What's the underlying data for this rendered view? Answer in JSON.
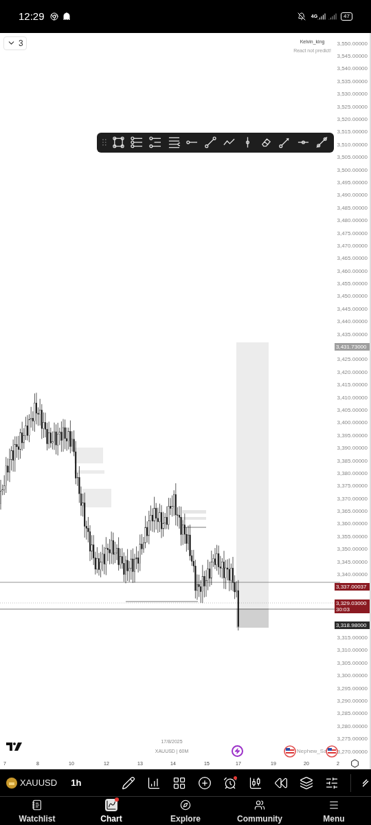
{
  "status_bar": {
    "time": "12:29",
    "network": "4G",
    "battery": "47"
  },
  "chart": {
    "layout_button": {
      "count": "3"
    },
    "author": {
      "name": "Kelvin_king",
      "note": "React not predict!"
    },
    "price_axis": [
      {
        "kind": "label",
        "text": "3,550.00000"
      },
      {
        "kind": "label",
        "text": "3,545.00000"
      },
      {
        "kind": "label",
        "text": "3,540.00000"
      },
      {
        "kind": "label",
        "text": "3,535.00000"
      },
      {
        "kind": "label",
        "text": "3,530.00000"
      },
      {
        "kind": "label",
        "text": "3,525.00000"
      },
      {
        "kind": "label",
        "text": "3,520.00000"
      },
      {
        "kind": "label",
        "text": "3,515.00000"
      },
      {
        "kind": "label",
        "text": "3,510.00000"
      },
      {
        "kind": "label",
        "text": "3,505.00000"
      },
      {
        "kind": "label",
        "text": "3,500.00000"
      },
      {
        "kind": "label",
        "text": "3,495.00000"
      },
      {
        "kind": "label",
        "text": "3,490.00000"
      },
      {
        "kind": "label",
        "text": "3,485.00000"
      },
      {
        "kind": "label",
        "text": "3,480.00000"
      },
      {
        "kind": "label",
        "text": "3,475.00000"
      },
      {
        "kind": "label",
        "text": "3,470.00000"
      },
      {
        "kind": "label",
        "text": "3,465.00000"
      },
      {
        "kind": "label",
        "text": "3,460.00000"
      },
      {
        "kind": "label",
        "text": "3,455.00000"
      },
      {
        "kind": "label",
        "text": "3,450.00000"
      },
      {
        "kind": "label",
        "text": "3,445.00000"
      },
      {
        "kind": "label",
        "text": "3,440.00000"
      },
      {
        "kind": "label",
        "text": "3,435.00000"
      },
      {
        "kind": "tag",
        "color": "#9e9e9e",
        "lines": [
          "3,431.73000"
        ]
      },
      {
        "kind": "label",
        "text": "3,425.00000"
      },
      {
        "kind": "label",
        "text": "3,420.00000"
      },
      {
        "kind": "label",
        "text": "3,415.00000"
      },
      {
        "kind": "label",
        "text": "3,410.00000"
      },
      {
        "kind": "label",
        "text": "3,405.00000"
      },
      {
        "kind": "label",
        "text": "3,400.00000"
      },
      {
        "kind": "label",
        "text": "3,395.00000"
      },
      {
        "kind": "label",
        "text": "3,390.00000"
      },
      {
        "kind": "label",
        "text": "3,385.00000"
      },
      {
        "kind": "label",
        "text": "3,380.00000"
      },
      {
        "kind": "label",
        "text": "3,375.00000"
      },
      {
        "kind": "label",
        "text": "3,370.00000"
      },
      {
        "kind": "label",
        "text": "3,365.00000"
      },
      {
        "kind": "label",
        "text": "3,360.00000"
      },
      {
        "kind": "label",
        "text": "3,355.00000"
      },
      {
        "kind": "label",
        "text": "3,350.00000"
      },
      {
        "kind": "label",
        "text": "3,345.00000"
      },
      {
        "kind": "label",
        "text": "3,340.00000"
      },
      {
        "kind": "tag",
        "color": "#8b1a22",
        "lines": [
          "3,337.00037"
        ]
      },
      {
        "kind": "tag",
        "color": "#8b1a22",
        "lines": [
          "3,329.03000",
          "30:03"
        ]
      },
      {
        "kind": "tag",
        "color": "#2a2a2a",
        "lines": [
          "3,318.98000"
        ]
      },
      {
        "kind": "label",
        "text": "3,315.00000"
      },
      {
        "kind": "label",
        "text": "3,310.00000"
      },
      {
        "kind": "label",
        "text": "3,305.00000"
      },
      {
        "kind": "label",
        "text": "3,300.00000"
      },
      {
        "kind": "label",
        "text": "3,295.00000"
      },
      {
        "kind": "label",
        "text": "3,290.00000"
      },
      {
        "kind": "label",
        "text": "3,285.00000"
      },
      {
        "kind": "label",
        "text": "3,280.00000"
      },
      {
        "kind": "label",
        "text": "3,275.00000"
      },
      {
        "kind": "label",
        "text": "3,270.00000"
      }
    ],
    "date": "17/8/2025",
    "symbol_interval": "XAUUSD | 60M",
    "overlay_user": "Nephew_Sa",
    "time_axis": [
      "7",
      "8",
      "10",
      "12",
      "13",
      "14",
      "15",
      "17",
      "19",
      "20",
      "2"
    ]
  },
  "symbol_bar": {
    "symbol": "XAUUSD",
    "interval": "1h",
    "alert_badge": true
  },
  "nav": [
    {
      "label": "Watchlist",
      "selected": false,
      "badge": false
    },
    {
      "label": "Chart",
      "selected": true,
      "badge": true
    },
    {
      "label": "Explore",
      "selected": false,
      "badge": false
    },
    {
      "label": "Community",
      "selected": false,
      "badge": false
    },
    {
      "label": "Menu",
      "selected": false,
      "badge": false
    }
  ]
}
